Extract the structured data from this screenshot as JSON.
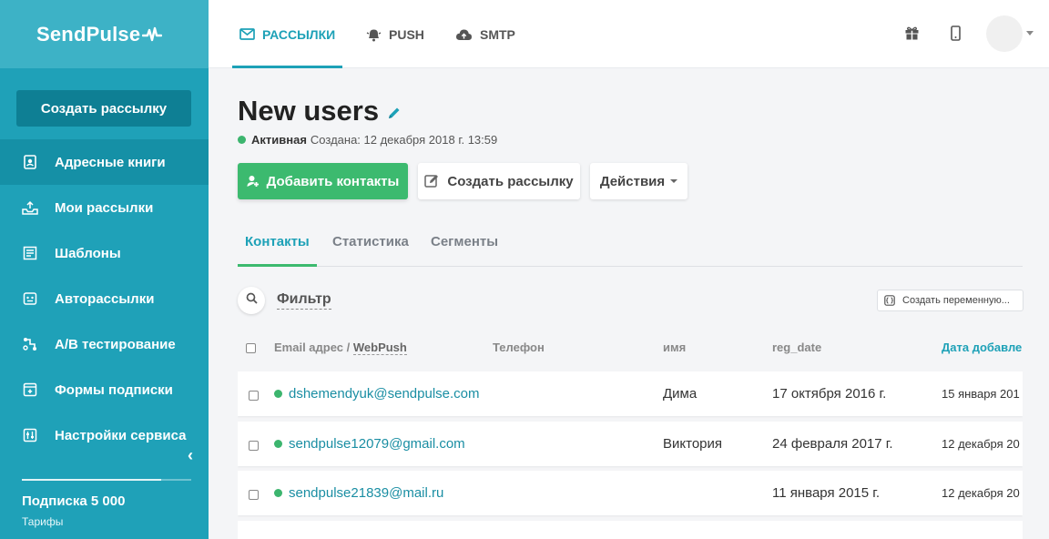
{
  "sidebar": {
    "brand": "SendPulse",
    "create_button": "Создать рассылку",
    "items": [
      {
        "label": "Адресные книги",
        "icon": "address-book-icon",
        "active": true
      },
      {
        "label": "Мои рассылки",
        "icon": "send-tray-icon"
      },
      {
        "label": "Шаблоны",
        "icon": "template-icon"
      },
      {
        "label": "Авторассылки",
        "icon": "automation-icon"
      },
      {
        "label": "A/B тестирование",
        "icon": "ab-test-icon"
      },
      {
        "label": "Формы подписки",
        "icon": "form-icon"
      },
      {
        "label": "Настройки сервиса",
        "icon": "settings-sliders-icon"
      }
    ],
    "subscription_title": "Подписка 5 000",
    "subscription_link": "Тарифы"
  },
  "topbar": {
    "tabs": [
      {
        "label": "РАССЫЛКИ",
        "icon": "envelope-icon",
        "active": true
      },
      {
        "label": "PUSH",
        "icon": "bell-icon"
      },
      {
        "label": "SMTP",
        "icon": "cloud-upload-icon"
      }
    ],
    "icons": [
      "gift-icon",
      "mobile-icon"
    ]
  },
  "main": {
    "title": "New users",
    "status": "Активная",
    "created": "Создана: 12 декабря 2018 г. 13:59",
    "buttons": {
      "add_contacts": "Добавить контакты",
      "create_campaign": "Создать рассылку",
      "actions": "Действия"
    },
    "subtabs": [
      "Контакты",
      "Статистика",
      "Сегменты"
    ],
    "filter_label": "Фильтр",
    "create_variable": "Создать переменную...",
    "table": {
      "headers": {
        "email": "Email адрес /",
        "webpush": "WebPush",
        "phone": "Телефон",
        "name": "имя",
        "reg_date": "reg_date",
        "date_added": "Дата добавле"
      },
      "rows": [
        {
          "email": "dshemendyuk@sendpulse.com",
          "phone": "",
          "name": "Дима",
          "reg_date": "17 октября 2016 г.",
          "date_added": "15 января 201"
        },
        {
          "email": "sendpulse12079@gmail.com",
          "phone": "",
          "name": "Виктория",
          "reg_date": "24 февраля 2017 г.",
          "date_added": "12 декабря 20"
        },
        {
          "email": "sendpulse21839@mail.ru",
          "phone": "",
          "name": "",
          "reg_date": "11 января 2015 г.",
          "date_added": "12 декабря 20"
        }
      ]
    }
  },
  "colors": {
    "sidebar": "#1fa1b8",
    "accent": "#1da1b7",
    "green": "#3cba6f"
  }
}
